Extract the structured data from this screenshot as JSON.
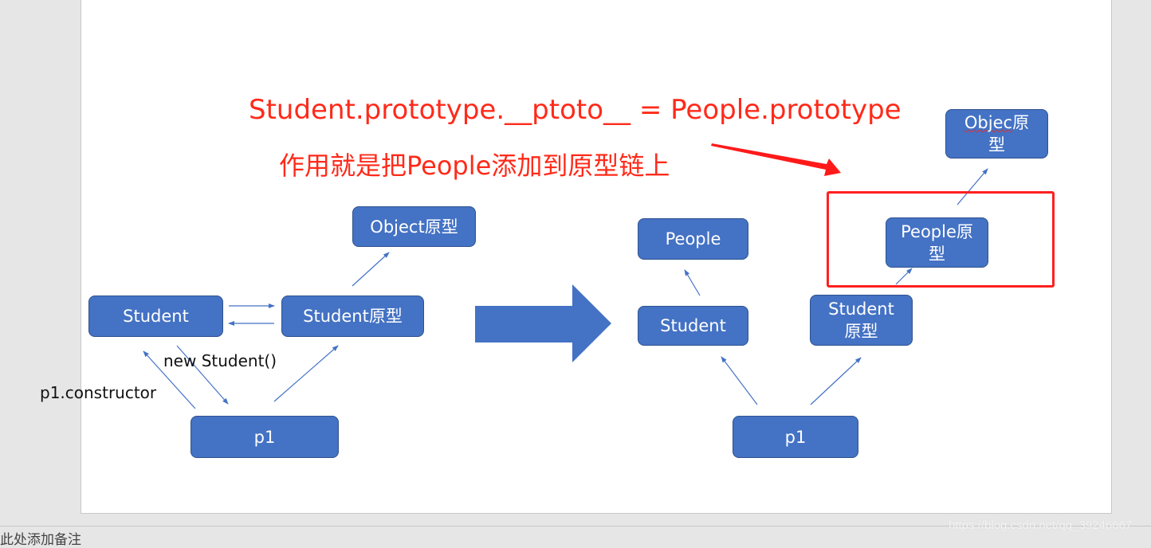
{
  "slide": {
    "title_formula": "Student.prototype.__ptoto__ = People.prototype",
    "subtitle": "作用就是把People添加到原型链上",
    "left_diagram": {
      "nodes": {
        "student": "Student",
        "student_proto": "Student原型",
        "object_proto": "Object原型",
        "p1": "p1"
      },
      "labels": {
        "new_student": "new Student()",
        "p1_constructor": "p1.constructor"
      }
    },
    "right_diagram": {
      "nodes": {
        "people": "People",
        "student": "Student",
        "student_proto_line1": "Student",
        "student_proto_line2": "原型",
        "p1": "p1",
        "people_proto_line1": "People原",
        "people_proto_line2": "型",
        "object_proto_line1_word": "Objec",
        "object_proto_line1_rest": "原",
        "object_proto_line2": "型"
      }
    },
    "colors": {
      "node_fill": "#4472c4",
      "node_border": "#2f528f",
      "connector": "#4472c4",
      "highlight_red": "#ff2020",
      "text_red": "#ff2a1a"
    }
  },
  "notes": {
    "placeholder": "此处添加备注"
  },
  "watermark": "https://blog.csdn.net/qq_39246667"
}
